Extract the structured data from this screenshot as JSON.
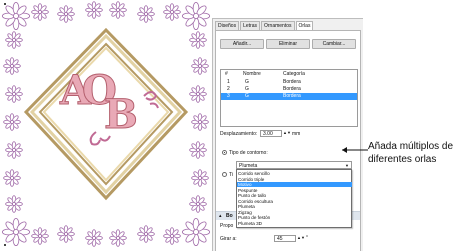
{
  "tabs": [
    "Diseños",
    "Letras",
    "Ornamentos",
    "Orlas"
  ],
  "toolbar": {
    "add": "Añadir...",
    "delete": "Eliminar",
    "change": "Cambiar..."
  },
  "table": {
    "headers": [
      "#",
      "Nombre",
      "Categoría"
    ],
    "rows": [
      {
        "num": "1",
        "name": "G",
        "category": "Bordera"
      },
      {
        "num": "2",
        "name": "G",
        "category": "Bordera"
      },
      {
        "num": "3",
        "name": "G",
        "category": "Bordera"
      }
    ]
  },
  "offset": {
    "label": "Desplazamiento:",
    "value": "3.00",
    "unit": "mm"
  },
  "outline": {
    "label": "Tipo de contorno:",
    "selected": "Plumeta",
    "options": [
      "Corrido sencillo",
      "Corrido triple",
      "Motivo",
      "Pespunte",
      "Punto de tallo",
      "Corrido escultura",
      "Plumeta",
      "Zigzag",
      "Punto de festón",
      "Plumeta 3D"
    ],
    "highlighted_index": 2
  },
  "partial": {
    "radio2": "Ti",
    "section": "Bo",
    "proportion": "Propo"
  },
  "rotate": {
    "label": "Girar a:",
    "value": "45",
    "unit": "°"
  },
  "callout": "Añada múltiplos de diferentes orlas",
  "colors": {
    "selection": "#3399ff",
    "letters": "#e39aa8",
    "flowers": "#a06aa8",
    "border": "#c8b57a"
  }
}
